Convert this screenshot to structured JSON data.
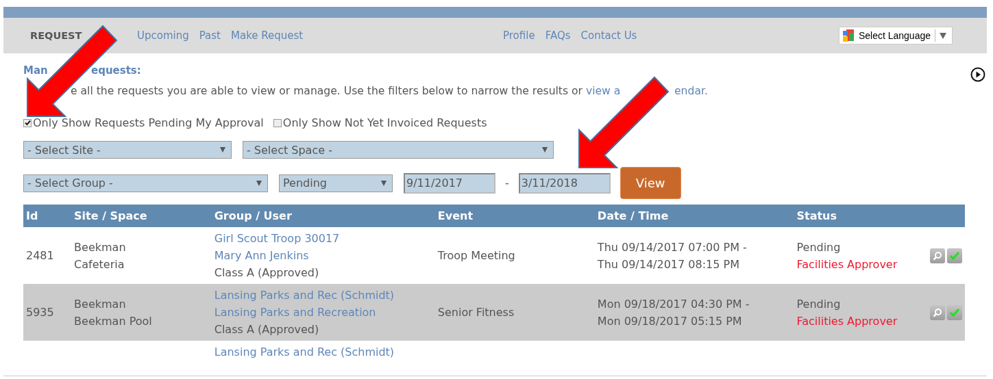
{
  "nav": {
    "links": [
      {
        "label": "REQUEST",
        "selected": true
      },
      {
        "label": "Upcoming",
        "selected": false
      },
      {
        "label": "Past",
        "selected": false
      },
      {
        "label": "Make Request",
        "selected": false
      }
    ],
    "center_links": [
      "Profile",
      "FAQs",
      "Contact Us"
    ],
    "language_select": {
      "label": "Select Language"
    }
  },
  "heading": {
    "start": "Man",
    "end": "equests:"
  },
  "intro": {
    "text": "e all the requests you are able to view or manage. Use the filters below to narrow the results or",
    "link_start": "view a",
    "link_end": "endar."
  },
  "checkboxes": [
    {
      "label": "Only Show Requests Pending My Approval",
      "checked": true
    },
    {
      "label": "Only Show Not Yet Invoiced Requests",
      "checked": false
    }
  ],
  "filters": {
    "site": "- Select Site -",
    "space": "- Select Space -",
    "group": "- Select Group -",
    "status": "Pending",
    "date_from": "9/11/2017",
    "separator": "-",
    "date_to": "3/11/2018",
    "button": "View"
  },
  "table": {
    "columns": [
      "Id",
      "Site / Space",
      "Group / User",
      "Event",
      "Date / Time",
      "Status"
    ],
    "rows": [
      {
        "id": "2481",
        "site": "Beekman",
        "space": "Cafeteria",
        "group": "Girl Scout Troop 30017",
        "user": "Mary Ann Jenkins",
        "class": "Class A (Approved)",
        "event": "Troop Meeting",
        "start": "Thu 09/14/2017 07:00 PM -",
        "end": "Thu 09/14/2017 08:15 PM",
        "status": "Pending",
        "approver": "Facilities Approver"
      },
      {
        "id": "5935",
        "site": "Beekman",
        "space": "Beekman Pool",
        "group": "Lansing Parks and Rec (Schmidt)",
        "user": "Lansing Parks and Recreation",
        "class": "Class A (Approved)",
        "event": "Senior Fitness",
        "start": "Mon 09/18/2017 04:30 PM -",
        "end": "Mon 09/18/2017 05:15 PM",
        "status": "Pending",
        "approver": "Facilities Approver"
      },
      {
        "group": "Lansing Parks and Rec (Schmidt)"
      }
    ]
  }
}
